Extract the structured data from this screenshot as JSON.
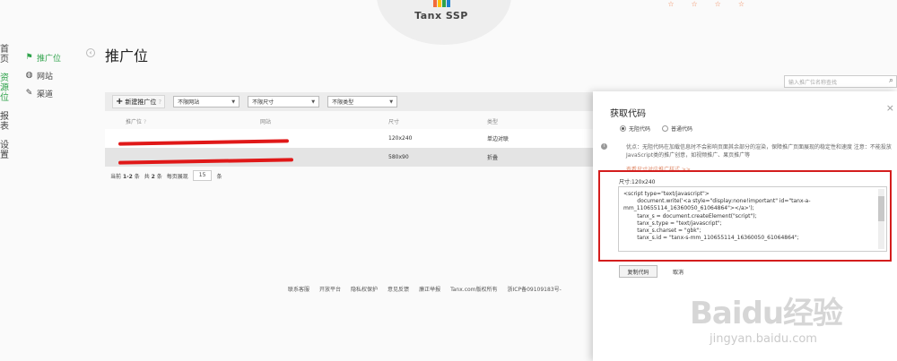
{
  "brand": {
    "name": "Tanx SSP",
    "colors": [
      "#f26b3a",
      "#ffc200",
      "#2ea24a",
      "#1e7fd0"
    ]
  },
  "top_icons": [
    "☆",
    "☆",
    "☆",
    "☆"
  ],
  "main_nav": [
    {
      "label": "首页",
      "active": false
    },
    {
      "label": "资源位",
      "active": true
    },
    {
      "label": "报表",
      "active": false
    },
    {
      "label": "设置",
      "active": false
    }
  ],
  "sub_nav": [
    {
      "label": "推广位",
      "icon": "flag-icon",
      "active": true
    },
    {
      "label": "网站",
      "icon": "globe-icon",
      "active": false
    },
    {
      "label": "渠道",
      "icon": "channel-icon",
      "active": false
    }
  ],
  "page_title": "推广位",
  "search": {
    "placeholder": "输入推广位名称查找"
  },
  "toolbar": {
    "new_button": "新建推广位",
    "filters": [
      "不限网站",
      "不限尺寸",
      "不限类型"
    ]
  },
  "table": {
    "headers": [
      "推广位",
      "网站",
      "尺寸",
      "类型"
    ],
    "rows": [
      {
        "name": "",
        "site": "",
        "size": "120x240",
        "type": "单边对联"
      },
      {
        "name": "",
        "site": "",
        "size": "580x90",
        "type": "折叠"
      }
    ]
  },
  "pagination": {
    "prefix": "当前",
    "range": "1-2",
    "unit1": "条",
    "total_prefix": "共",
    "total": "2",
    "unit2": "条",
    "per_page_label": "每页展现",
    "per_page": "15",
    "unit3": "条"
  },
  "footer": [
    "联系客服",
    "开放平台",
    "隐私权保护",
    "意见反馈",
    "廉正举报",
    "Tanx.com版权所有",
    "浙ICP备09109183号-"
  ],
  "panel": {
    "title": "获取代码",
    "close": "×",
    "radio_options": [
      "无阻代码",
      "普通代码"
    ],
    "info": "优点：无阻代码在加载信息时不会影响页面其余部分的渲染，保障推广页面展现的稳定性和速度  注意：不能投放JavaScript类的推广创意，如视频推广、果页推广等",
    "info_link": "查看尺寸对应推广样式 >>",
    "size_label": "尺寸:120x240",
    "code_lines": [
      "<script type=\"text/javascript\">",
      "        document.write('<a style=\"display:none!important\" id=\"tanx-a-",
      "mm_110655114_16360050_61064864\"></a>');",
      "        tanx_s = document.createElement(\"script\");",
      "        tanx_s.type = \"text/javascript\";",
      "        tanx_s.charset = \"gbk\";",
      "        tanx_s.id = \"tanx-s-mm_110655114_16360050_61064864\";"
    ],
    "copy_button": "复制代码",
    "cancel_button": "取消"
  },
  "watermark": {
    "logo": "Baidu经验",
    "url": "jingyan.baidu.com"
  }
}
